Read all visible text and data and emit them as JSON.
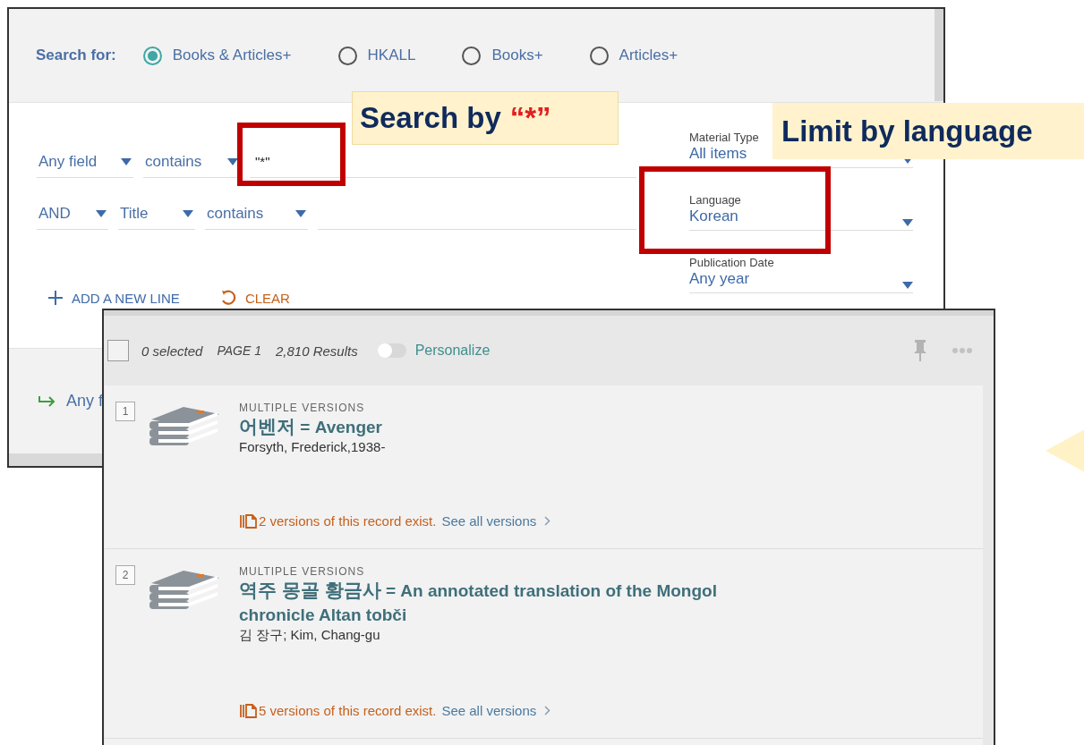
{
  "search_panel": {
    "search_for": {
      "label": "Search for:",
      "options": [
        {
          "label": "Books & Articles+",
          "selected": true
        },
        {
          "label": "HKALL",
          "selected": false
        },
        {
          "label": "Books+",
          "selected": false
        },
        {
          "label": "Articles+",
          "selected": false
        }
      ]
    },
    "query_lines": [
      {
        "field": "Any field",
        "operator": "contains",
        "value": "\"*\""
      },
      {
        "boolean": "AND",
        "field": "Title",
        "operator": "contains"
      }
    ],
    "filters": [
      {
        "label": "Material Type",
        "value": "All items"
      },
      {
        "label": "Language",
        "value": "Korean"
      },
      {
        "label": "Publication Date",
        "value": "Any year"
      }
    ],
    "add_line": "ADD A NEW LINE",
    "clear": "CLEAR",
    "summary": "Any f"
  },
  "results_panel": {
    "toolbar": {
      "checked": false,
      "selected": "0 selected",
      "page": "PAGE 1",
      "count": "2,810 Results",
      "personalize": {
        "label": "Personalize",
        "on": false
      }
    },
    "results": [
      {
        "number": "1",
        "type_label": "MULTIPLE VERSIONS",
        "title_native": "어벤저",
        "title_translation": "= Avenger",
        "author": "Forsyth, Frederick,1938-",
        "versions_note": "2 versions of this record exist.",
        "versions_link": "See all versions"
      },
      {
        "number": "2",
        "type_label": "MULTIPLE VERSIONS",
        "title_native": "역주 몽골 황금사",
        "title_translation": "= An annotated translation of the Mongol",
        "title_rest": "chronicle Altan tobči",
        "author": "김 장구; Kim, Chang-gu",
        "versions_note": "5 versions of this record exist.",
        "versions_link": "See all versions"
      }
    ]
  },
  "callouts": [
    {
      "text": "Search by",
      "mark": "“*”"
    },
    {
      "text": "Limit by language"
    }
  ]
}
